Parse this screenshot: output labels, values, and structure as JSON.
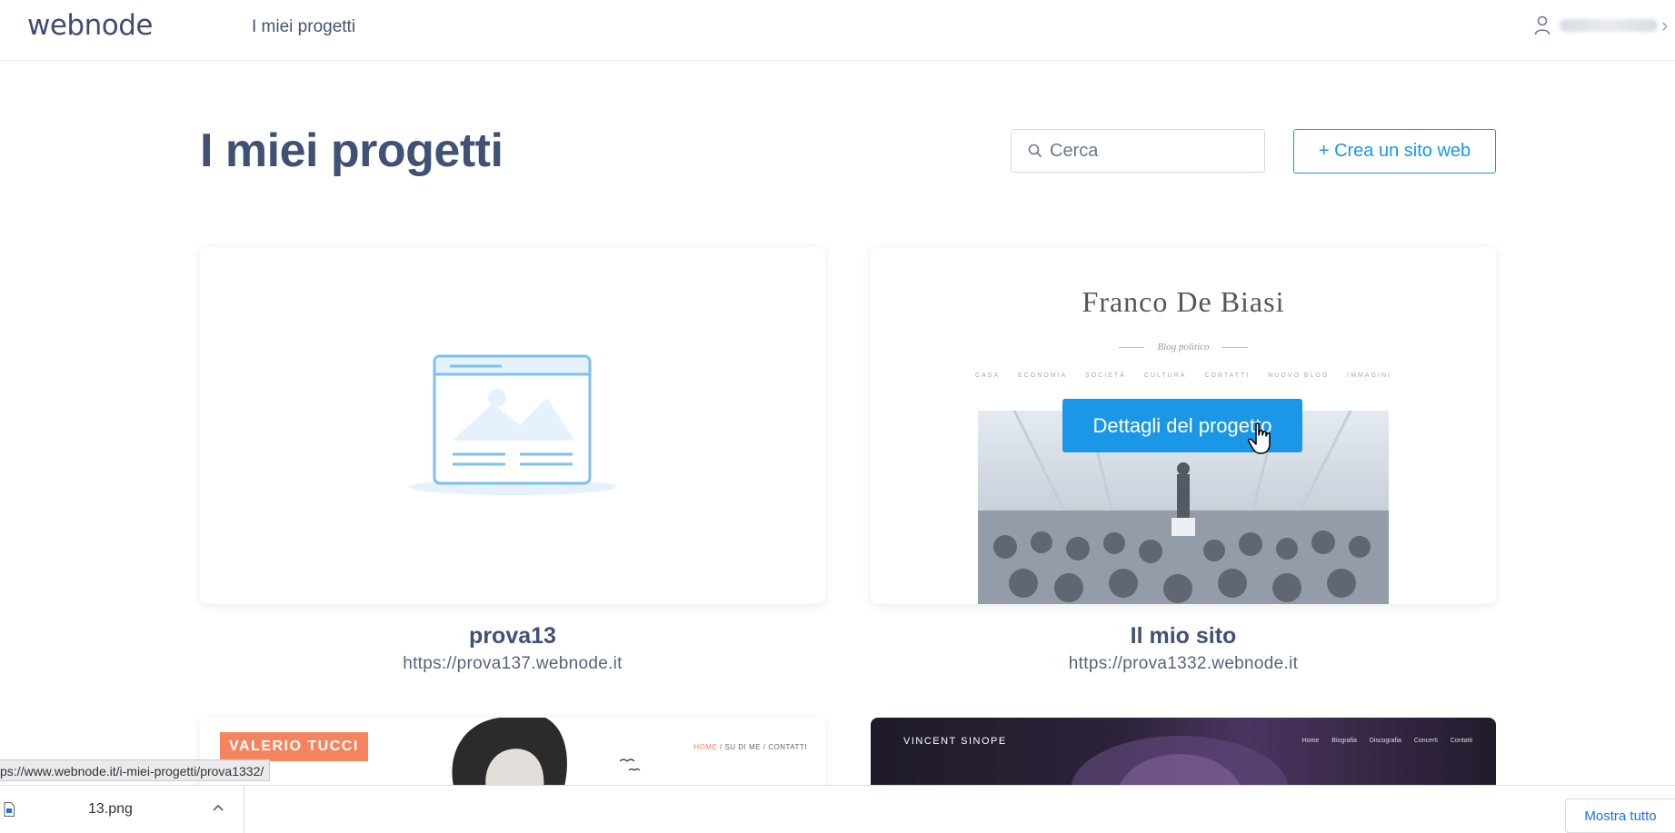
{
  "app": {
    "logo_text": "webnode",
    "nav_link": "I miei progetti",
    "user_icon": "user-icon"
  },
  "page": {
    "title": "I miei progetti",
    "search_placeholder": "Cerca",
    "create_button": "+ Crea un sito web"
  },
  "projects": [
    {
      "name": "prova13",
      "url": "https://prova137.webnode.it",
      "preview": "placeholder-website-icon"
    },
    {
      "name": "Il mio sito",
      "url": "https://prova1332.webnode.it",
      "preview_title": "Franco De Biasi",
      "preview_subtitle": "Blog politico",
      "preview_menu": [
        "CASA",
        "ECONOMIA",
        "SOCIETÀ",
        "CULTURA",
        "CONTATTI",
        "NUOVO BLOG",
        "IMMAGINI"
      ],
      "hover_button": "Dettagli del progetto"
    }
  ],
  "more_previews": [
    {
      "brand": "VALERIO TUCCI",
      "nav": [
        "HOME",
        "SU DI ME",
        "CONTATTI"
      ]
    },
    {
      "brand": "VINCENT SINOPE",
      "nav": [
        "Home",
        "Biografia",
        "Discografia",
        "Concerti",
        "Contatti"
      ]
    }
  ],
  "browser": {
    "status_url": "ps://www.webnode.it/i-miei-progetti/prova1332/",
    "download_file": "13.png",
    "show_all": "Mostra tutto"
  },
  "colors": {
    "accent": "#1a97e6",
    "heading": "#3f5275",
    "valerio_accent": "#f4845f"
  }
}
